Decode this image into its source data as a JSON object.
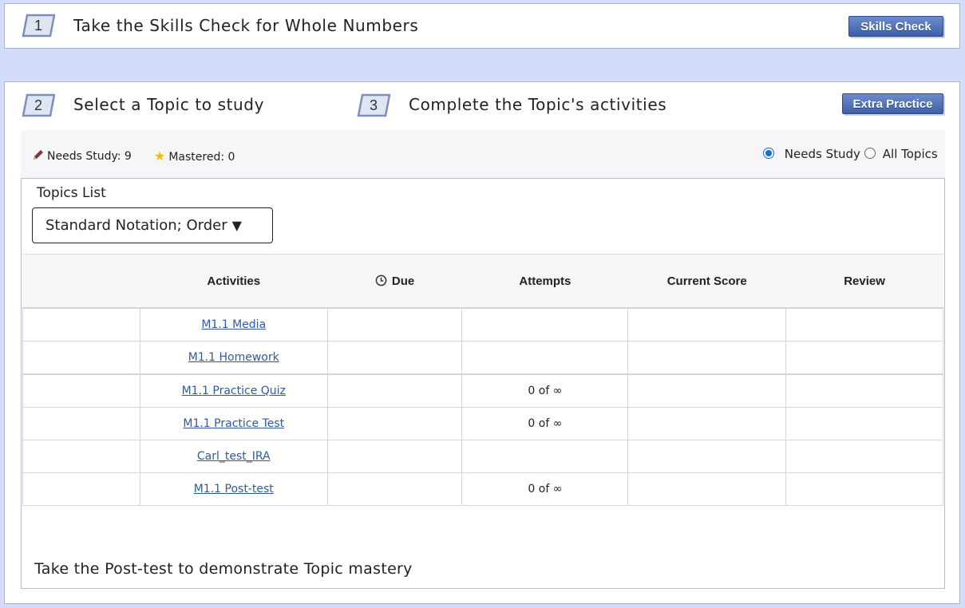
{
  "step1": {
    "number": "1",
    "text": "Take the Skills Check for Whole Numbers",
    "button_label": "Skills Check"
  },
  "step2": {
    "number": "2",
    "text": "Select a Topic to study"
  },
  "step3": {
    "number": "3",
    "text": "Complete the Topic's activities",
    "button_label": "Extra Practice"
  },
  "status": {
    "needs_study": "Needs Study: 9",
    "mastered": "Mastered: 0",
    "filter_options": [
      {
        "label": "Needs Study",
        "selected": true
      },
      {
        "label": "All Topics",
        "selected": false
      }
    ]
  },
  "topics": {
    "label": "Topics List",
    "selected": "Standard Notation; Order",
    "arrow": "▼"
  },
  "table": {
    "headers": [
      "Activities",
      "Due",
      "Attempts",
      "Current Score",
      "Review"
    ],
    "rows": [
      {
        "activity": "M1.1 Media",
        "due": "",
        "attempts": "",
        "score": "",
        "review": ""
      },
      {
        "activity": "M1.1 Homework",
        "due": "",
        "attempts": "",
        "score": "",
        "review": ""
      },
      {
        "activity": "M1.1 Practice Quiz",
        "due": "",
        "attempts": "0 of ∞",
        "score": "",
        "review": ""
      },
      {
        "activity": "M1.1 Practice Test",
        "due": "",
        "attempts": "0 of ∞",
        "score": "",
        "review": ""
      },
      {
        "activity": "Carl_test_IRA",
        "due": "",
        "attempts": "",
        "score": "",
        "review": ""
      },
      {
        "activity": "M1.1 Post-test",
        "due": "",
        "attempts": "0 of ∞",
        "score": "",
        "review": ""
      }
    ]
  },
  "footer": "Take the Post-test to demonstrate Topic mastery",
  "colors": {
    "background": "#d3dcfb",
    "button": "#3c5fa6",
    "link": "#2f5a9e",
    "pencil": "#7a3b3b",
    "star": "#f2b90f"
  }
}
